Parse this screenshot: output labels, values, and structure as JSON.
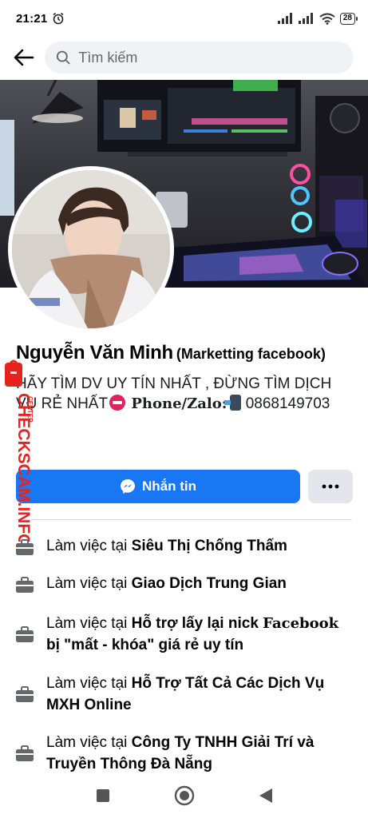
{
  "status_bar": {
    "time": "21:21",
    "battery": "28"
  },
  "search": {
    "placeholder": "Tìm kiếm"
  },
  "profile": {
    "name": "Nguyễn Văn Minh",
    "alt_name": "(Marketting facebook)",
    "bio_part1": "HÃY TÌM DV UY TÍN NHẤT , ĐỪNG TÌM DỊCH VỤ RẺ NHẤT",
    "bio_phone_label": "Phone/Zalo:",
    "bio_phone": "0868149703"
  },
  "actions": {
    "message_label": "Nhắn tin"
  },
  "work_prefix": "Làm việc tại",
  "work": [
    {
      "place": "Siêu Thị Chống Thấm"
    },
    {
      "place": "Giao Dịch Trung Gian"
    },
    {
      "place_part1": "Hỗ trợ lấy lại nick",
      "place_part2": "Facebook",
      "place_part3": "bị \"mất - khóa\" giá rẻ uy tín"
    },
    {
      "place": "Hỗ Trợ Tất Cả Các Dịch Vụ MXH Online"
    },
    {
      "place": "Công Ty TNHH Giải Trí và Truyền Thông Đà Nẵng"
    }
  ],
  "watermark": {
    "text": "CHECKSCAM.INFO",
    "sub": "CENTER"
  },
  "colors": {
    "primary": "#1877f2",
    "secondary_button": "#e4e6eb",
    "search_bg": "#f0f2f5"
  }
}
